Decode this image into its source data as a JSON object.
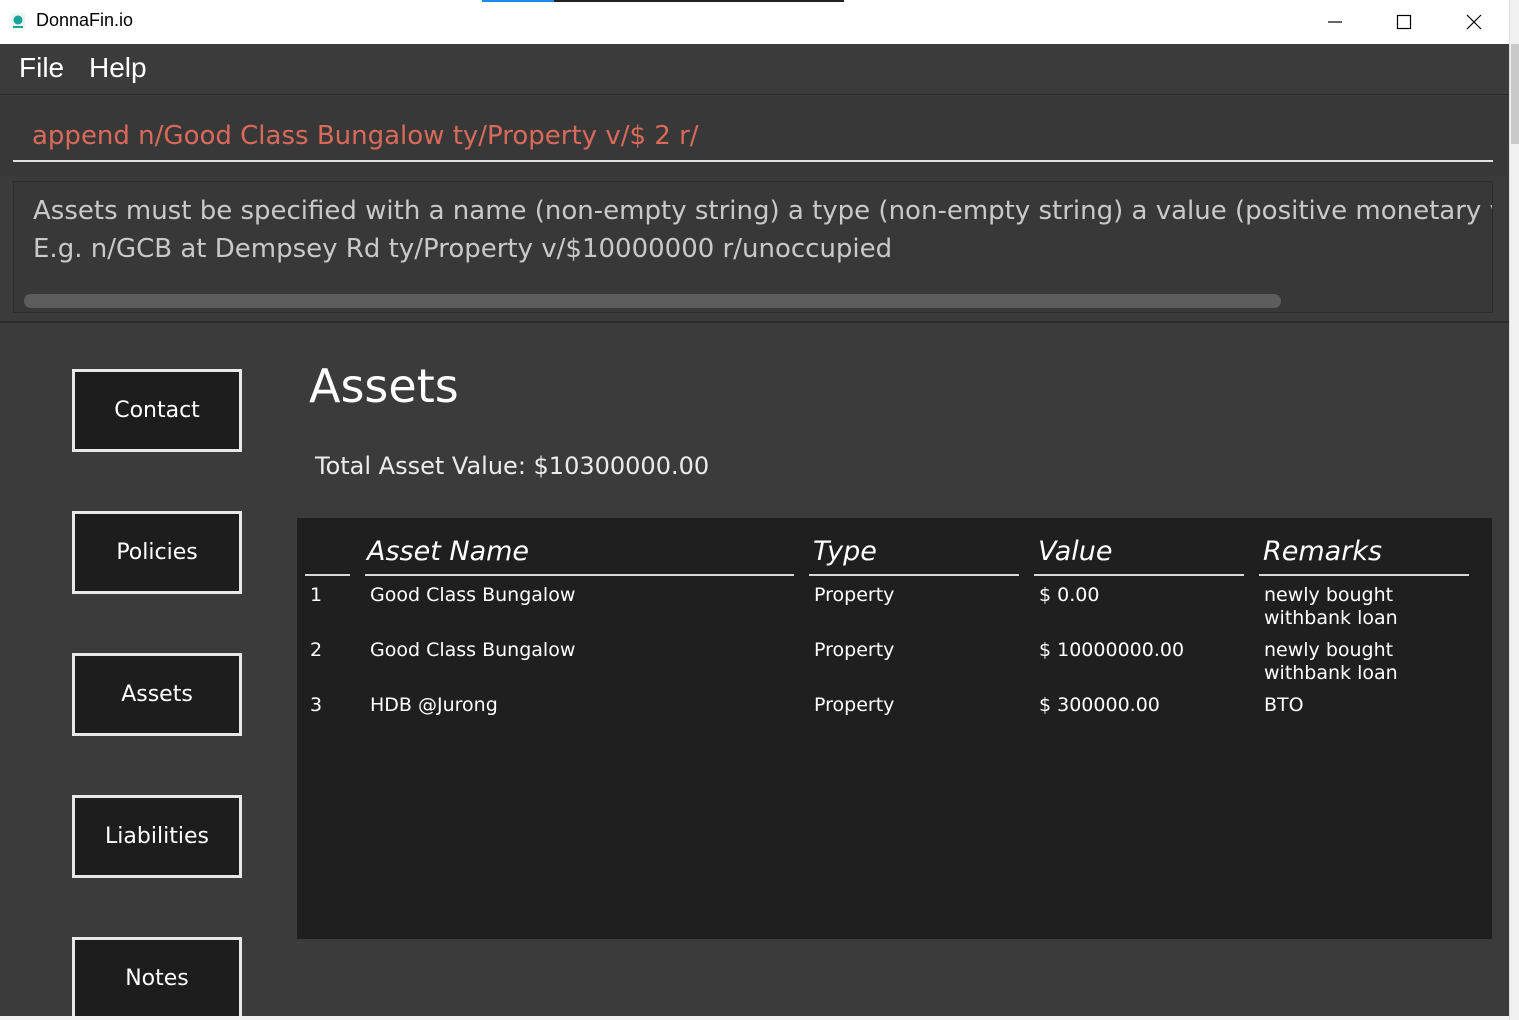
{
  "window": {
    "title": "DonnaFin.io",
    "minimize_glyph": "—",
    "maximize_glyph": "☐",
    "close_glyph": "✕"
  },
  "menu": {
    "file": "File",
    "help": "Help"
  },
  "command": {
    "value": "append n/Good Class Bungalow ty/Property v/$ 2 r/"
  },
  "result": {
    "line1": "Assets must be specified with a name (non-empty string) a type (non-empty string) a value (positive monetary value) a remark",
    "line2": "E.g. n/GCB at Dempsey Rd ty/Property v/$10000000 r/unoccupied"
  },
  "nav": {
    "contact": "Contact",
    "policies": "Policies",
    "assets": "Assets",
    "liabilities": "Liabilities",
    "notes": "Notes"
  },
  "page": {
    "title": "Assets",
    "total": "Total Asset Value: $10300000.00"
  },
  "table": {
    "headers": {
      "name": "Asset Name",
      "type": "Type",
      "value": "Value",
      "remarks": "Remarks"
    },
    "rows": [
      {
        "index": "1",
        "name": "Good Class Bungalow",
        "type": "Property",
        "value": "$ 0.00",
        "remarks": "newly bought withbank loan"
      },
      {
        "index": "2",
        "name": "Good Class Bungalow",
        "type": "Property",
        "value": "$ 10000000.00",
        "remarks": "newly bought withbank loan"
      },
      {
        "index": "3",
        "name": "HDB @Jurong",
        "type": "Property",
        "value": "$ 300000.00",
        "remarks": "BTO"
      }
    ]
  },
  "colors": {
    "background": "#3b3b3b",
    "panel": "#1f1f1f",
    "command_text": "#d96a5a",
    "nav_border": "#e8e8e8"
  },
  "icons": [
    "app-logo-icon",
    "minimize-icon",
    "maximize-icon",
    "close-icon"
  ]
}
